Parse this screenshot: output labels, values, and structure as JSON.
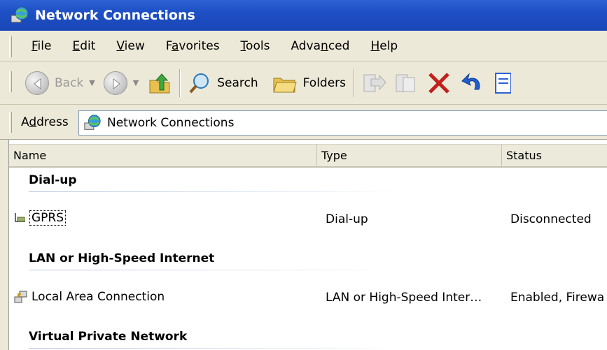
{
  "window": {
    "title": "Network Connections"
  },
  "menu": {
    "items": [
      {
        "pre": "",
        "u": "F",
        "post": "ile"
      },
      {
        "pre": "",
        "u": "E",
        "post": "dit"
      },
      {
        "pre": "",
        "u": "V",
        "post": "iew"
      },
      {
        "pre": "F",
        "u": "a",
        "post": "vorites"
      },
      {
        "pre": "",
        "u": "T",
        "post": "ools"
      },
      {
        "pre": "Adva",
        "u": "n",
        "post": "ced"
      },
      {
        "pre": "",
        "u": "H",
        "post": "elp"
      }
    ]
  },
  "toolbar": {
    "back": "Back",
    "search": "Search",
    "folders": "Folders"
  },
  "address": {
    "label_pre": "A",
    "label_u": "d",
    "label_post": "dress",
    "value": "Network Connections"
  },
  "list": {
    "columns": [
      "Name",
      "Type",
      "Status"
    ],
    "groups": [
      {
        "title": "Dial-up",
        "rows": [
          {
            "name": "GPRS",
            "type": "Dial-up",
            "status": "Disconnected"
          }
        ]
      },
      {
        "title": "LAN or High-Speed Internet",
        "rows": [
          {
            "name": "Local Area Connection",
            "type": "LAN or High-Speed Inter…",
            "status": "Enabled, Firewa"
          }
        ]
      },
      {
        "title": "Virtual Private Network",
        "rows": []
      }
    ]
  }
}
